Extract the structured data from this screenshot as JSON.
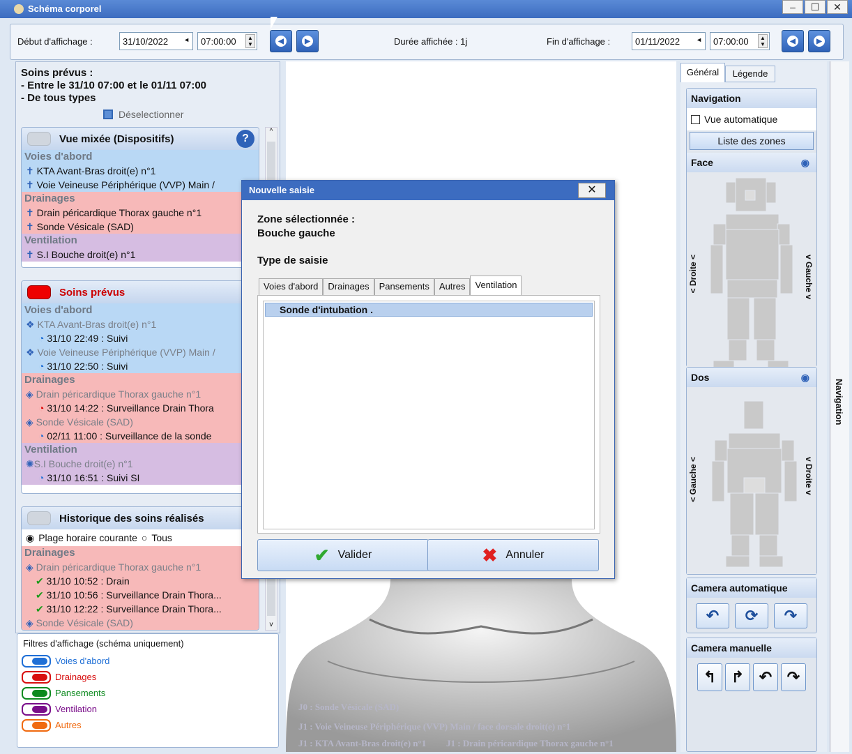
{
  "window": {
    "title": "Schéma corporel",
    "min": "–",
    "max": "☐",
    "close": "✕"
  },
  "toolbar": {
    "start_label": "Début d'affichage :",
    "start_date": "31/10/2022",
    "start_time": "07:00:00",
    "duration": "Durée affichée : 1j",
    "end_label": "Fin d'affichage :",
    "end_date": "01/11/2022",
    "end_time": "07:00:00"
  },
  "left": {
    "header_title": "Soins prévus :",
    "header_line1": "- Entre le 31/10 07:00 et le 01/11 07:00",
    "header_line2": "- De tous types",
    "deselect": "Déselectionner",
    "mixed": {
      "title": "Vue mixée (Dispositifs)",
      "sec1": "Voies d'abord",
      "r1": "KTA Avant-Bras droit(e) n°1",
      "r2": "Voie Veineuse Périphérique (VVP) Main /",
      "sec2": "Drainages",
      "r3": "Drain péricardique Thorax gauche n°1",
      "r4": "Sonde Vésicale (SAD)",
      "sec3": "Ventilation",
      "r5": "S.I Bouche droit(e) n°1"
    },
    "planned": {
      "title": "Soins prévus",
      "sec1": "Voies d'abord",
      "r1": "KTA Avant-Bras droit(e) n°1",
      "r1a": "31/10 22:49 : Suivi",
      "r2": "Voie Veineuse Périphérique (VVP) Main /",
      "r2a": "31/10 22:50 : Suivi",
      "sec2": "Drainages",
      "r3": "Drain péricardique Thorax gauche n°1",
      "r3a": "31/10 14:22 : Surveillance Drain Thora",
      "r4": "Sonde Vésicale (SAD)",
      "r4a": "02/11 11:00 : Surveillance de la sonde",
      "sec3": "Ventilation",
      "r5": "S.I Bouche droit(e) n°1",
      "r5a": "31/10 16:51 : Suivi SI"
    },
    "history": {
      "title": "Historique des soins réalisés",
      "opt1": "Plage horaire courante",
      "opt2": "Tous",
      "sec1": "Drainages",
      "r1": "Drain péricardique Thorax gauche n°1",
      "r1a": "31/10 10:52 : Drain",
      "r1b": "31/10 10:56 : Surveillance Drain Thora...",
      "r1c": "31/10 12:22 : Surveillance Drain Thora...",
      "r2": "Sonde Vésicale (SAD)"
    },
    "filters": {
      "title": "Filtres d'affichage (schéma uniquement)",
      "items": [
        {
          "label": "Voies d'abord",
          "color": "#1f6fd6"
        },
        {
          "label": "Drainages",
          "color": "#d80f0f"
        },
        {
          "label": "Pansements",
          "color": "#0d8a1f"
        },
        {
          "label": "Ventilation",
          "color": "#7a0e8a"
        },
        {
          "label": "Autres",
          "color": "#f06a10"
        }
      ]
    }
  },
  "center": {
    "labels": [
      "J0 : Sonde Vésicale (SAD)",
      "J1 : Voie Veineuse Périphérique (VVP) Main / face dorsale droit(e) n°1",
      "J1 : KTA Avant-Bras droit(e) n°1",
      "J1 : Drain péricardique Thorax gauche n°1"
    ]
  },
  "right": {
    "tab1": "Général",
    "tab2": "Légende",
    "nav": "Navigation",
    "auto_view": "Vue automatique",
    "zones": "Liste des zones",
    "face": "Face",
    "dos": "Dos",
    "droite": "< Droite <",
    "gauche": "v Gauche v",
    "gauche2": "< Gauche <",
    "droite2": "v Droite v",
    "cam_auto": "Camera automatique",
    "cam_man": "Camera manuelle",
    "vertical_tab": "Navigation"
  },
  "dialog": {
    "title": "Nouvelle saisie",
    "close": "✕",
    "zone_label": "Zone sélectionnée :",
    "zone_value": "Bouche gauche",
    "type_label": "Type de saisie",
    "tabs": [
      "Voies d'abord",
      "Drainages",
      "Pansements",
      "Autres",
      "Ventilation"
    ],
    "selected_item": "Sonde d'intubation .",
    "ok": "Valider",
    "cancel": "Annuler"
  }
}
